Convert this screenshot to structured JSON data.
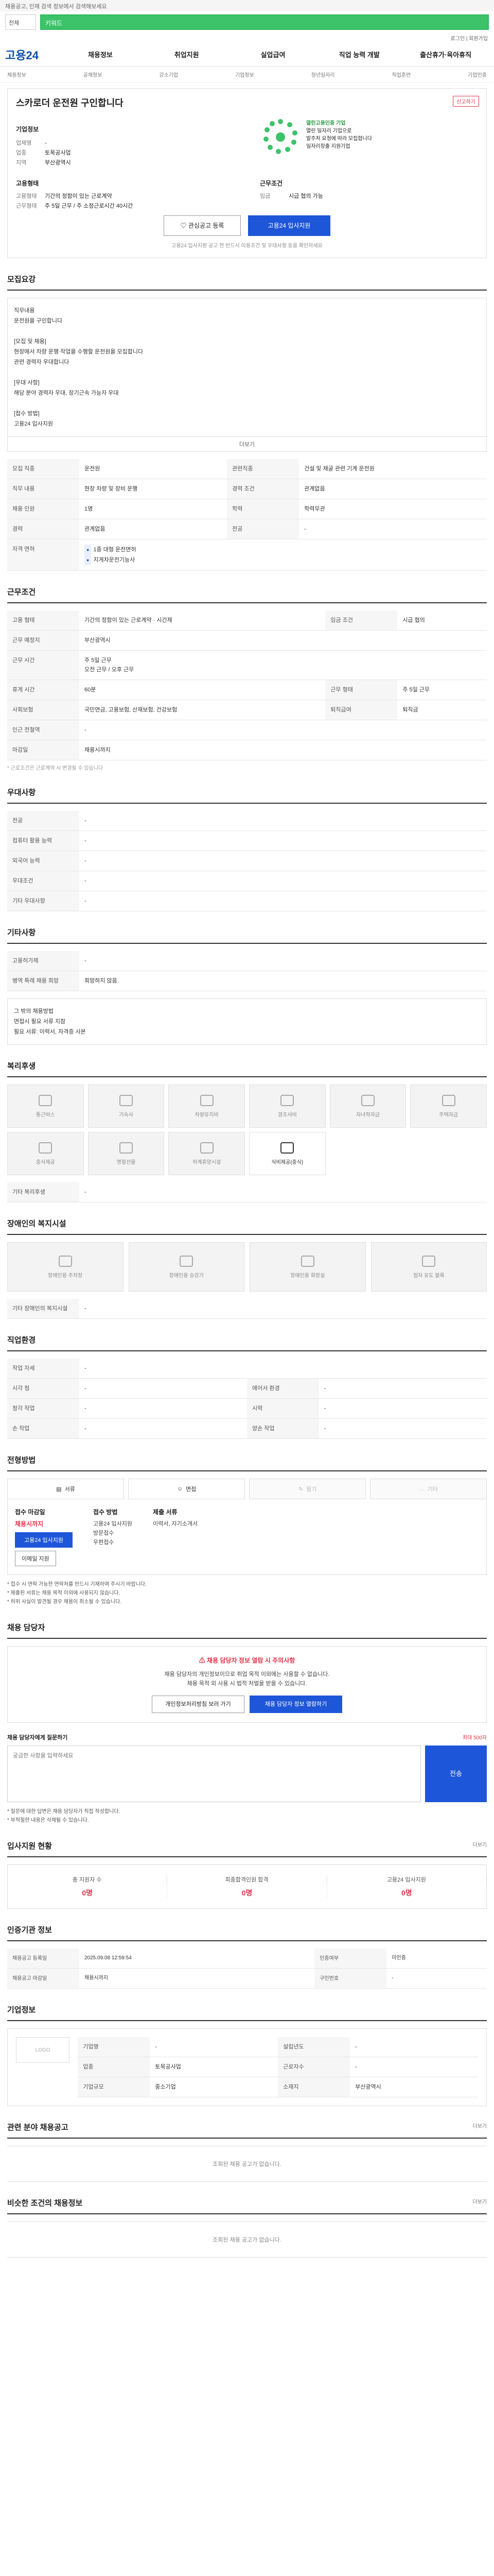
{
  "topbar": {
    "notice": "채용공고, 인재 검색 정보에서 검색해보세요"
  },
  "search": {
    "category": "전체",
    "query": "키워드"
  },
  "util": {
    "links": "로그인 | 회원가입"
  },
  "gnb": {
    "logo": "고용24",
    "items": [
      "채용정보",
      "취업지원",
      "실업급여",
      "직업 능력 개발",
      "출산휴가·육아휴직"
    ]
  },
  "subnav": {
    "items": [
      "채용정보",
      "공채정보",
      "강소기업",
      "기업정보",
      "청년일자리",
      "직업훈련",
      "기업인증"
    ]
  },
  "job": {
    "title": "스카로더 운전원 구인합니다",
    "report": "신고하기",
    "company_label": "기업정보",
    "company": [
      {
        "k": "업체명",
        "v": "-"
      },
      {
        "k": "업종",
        "v": "토목공사업"
      },
      {
        "k": "지역",
        "v": "부산광역시"
      }
    ],
    "emblem_title": "열린고용인증 기업",
    "emblem_lines": [
      "열린 일자리 기업으로",
      "발주처 요청에 따라 모집합니다",
      "일자리창출 지원기업"
    ],
    "hire_label": "고용형태",
    "hire": [
      {
        "k": "고용형태",
        "v": "기간의 정함이 있는 근로계약"
      },
      {
        "k": "근무형태",
        "v": "주 5일 근무 / 주 소정근로시간 40시간"
      }
    ],
    "work_label": "근무조건",
    "work": [
      {
        "k": "임금",
        "v": "시급 협의 가능"
      }
    ],
    "btn_interest": "관심공고 등록",
    "btn_apply": "고용24 입사지원",
    "disclaimer": "고용24 입사지원 공고 전 반드시 이용조건 및 우대사항 등을 확인하세요"
  },
  "detail": {
    "title": "모집요강",
    "body": "직무내용\n 운전원을 구인합니다\n\n[모집 및 채용]\n 현장에서 차량 운행 작업을 수행할 운전원을 모집합니다\n 관련 경력자 우대합니다\n\n[우대 사항]\n 해당 분야 경력자 우대, 장기근속 가능자 우대\n\n[접수 방법]\n 고용24 입사지원",
    "more": "더보기",
    "rows": [
      {
        "k": "모집 직종",
        "v": "운전원",
        "k2": "관련직종",
        "v2": "건설 및 채굴 관련 기계 운전원"
      },
      {
        "k": "직무 내용",
        "v": "현장 차량 및 장비 운행",
        "k2": "경력 조건",
        "v2": "관계없음"
      },
      {
        "k": "채용 인원",
        "v": "1명",
        "k2": "학력",
        "v2": "학력무관"
      },
      {
        "k": "경력",
        "v": "관계없음",
        "k2": "전공",
        "v2": "-"
      }
    ],
    "license_k": "자격 면허",
    "licenses": [
      "1종 대형 운전면허",
      "지게차운전기능사"
    ]
  },
  "condition": {
    "title": "근무조건",
    "rows": [
      {
        "k": "고용 형태",
        "v": "기간의 정함이 있는 근로계약 · 시간제",
        "k2": "임금 조건",
        "v2": "시급 협의"
      },
      {
        "k": "근무 예정지",
        "v": "부산광역시",
        "k2": "",
        "v2": ""
      },
      {
        "k": "근무 시간",
        "v": "주 5일 근무\n오전 근무 / 오후 근무",
        "k2": "",
        "v2": ""
      },
      {
        "k": "휴게 시간",
        "v": "60분",
        "k2": "근무 형태",
        "v2": "주 5일 근무"
      },
      {
        "k": "사회보험",
        "v": "국민연금, 고용보험, 산재보험, 건강보험",
        "k2": "퇴직급여",
        "v2": "퇴직금"
      },
      {
        "k": "인근 전철역",
        "v": "-",
        "k2": "",
        "v2": ""
      },
      {
        "k": "마감일",
        "v": "채용시까지",
        "k2": "",
        "v2": ""
      }
    ],
    "note": "* 근로조건은 근로계약 시 변경될 수 있습니다"
  },
  "preference": {
    "title": "우대사항",
    "rows": [
      {
        "k": "전공",
        "v": "-"
      },
      {
        "k": "컴퓨터 활용 능력",
        "v": "-"
      },
      {
        "k": "외국어 능력",
        "v": "-"
      },
      {
        "k": "우대조건",
        "v": "-"
      },
      {
        "k": "기타 우대사항",
        "v": "-"
      }
    ]
  },
  "other": {
    "title": "기타사항",
    "rows": [
      {
        "k": "고용허가제",
        "v": "-"
      },
      {
        "k": "병역 특례 채용 희망",
        "v": "희망하지 않음"
      }
    ],
    "box": "그 밖의 채용방법\n 면접시 필요 서류 지참\n 필요 서류: 이력서, 자격증 사본"
  },
  "welfare": {
    "title": "복리후생",
    "items": [
      "통근버스",
      "기숙사",
      "차량유지비",
      "경조사비",
      "자녀학자금",
      "주택자금",
      "중식제공",
      "명절선물",
      "하계휴양시설",
      "식비제공(중식)"
    ],
    "active": 9,
    "other_k": "기타 복리후생",
    "other_v": "-"
  },
  "disability": {
    "title": "장애인의 복지시설",
    "items": [
      "장애인용 주차장",
      "장애인용 승강기",
      "장애인용 화장실",
      "점자 유도 블록"
    ],
    "other_k": "기타 장애인의 복지시설",
    "other_v": "-"
  },
  "pref2": {
    "title": "직업환경",
    "rows": [
      {
        "k": "작업 자세",
        "v": "-",
        "k2": "",
        "v2": ""
      },
      {
        "k": "시각 청",
        "v": "-",
        "k2": "에어서 환경",
        "v2": "-"
      },
      {
        "k": "청각 작업",
        "v": "-",
        "k2": "시력",
        "v2": "-"
      },
      {
        "k": "손 작업",
        "v": "-",
        "k2": "양손 작업",
        "v2": "-"
      }
    ]
  },
  "apply": {
    "title": "전형방법",
    "tabs": [
      "서류",
      "면접",
      "필기",
      "기타"
    ],
    "dim_tabs": [
      2,
      3
    ],
    "col1_title": "접수 마감일",
    "deadline": "채용시까지",
    "btn_apply": "고용24 입사지원",
    "btn_email": "이메일 지원",
    "col2_title": "접수 방법",
    "methods": [
      "고용24 입사지원",
      "방문접수",
      "우편접수"
    ],
    "col3_title": "제출 서류",
    "docs": [
      "이력서, 자기소개서"
    ],
    "bullets": [
      "* 접수 시 연락 가능한 연락처를 반드시 기재하여 주시기 바랍니다.",
      "* 제출된 서류는 채용 목적 이외에 사용되지 않습니다.",
      "* 허위 사실이 발견될 경우 채용이 취소될 수 있습니다."
    ]
  },
  "contact": {
    "title": "채용 담당자",
    "warn_title": "채용 담당자 정보 열람 시 주의사항",
    "warn_lines": [
      "채용 담당자의 개인정보이므로 취업 목적 이외에는 사용할 수 없습니다.",
      "채용 목적 외 사용 시 법적 처벌을 받을 수 있습니다."
    ],
    "btn_a": "개인정보처리방침 보러 가기",
    "btn_b": "채용 담당자 정보 열람하기",
    "qa_label": "채용 담당자에게 질문하기",
    "qa_limit": "최대 500자",
    "qa_placeholder": "궁금한 사항을 입력하세요",
    "qa_send": "전송",
    "qa_notes": [
      "* 질문에 대한 답변은 채용 담당자가 직접 작성합니다.",
      "* 부적절한 내용은 삭제될 수 있습니다."
    ]
  },
  "stats": {
    "title": "입사지원 현황",
    "note": "더보기",
    "items": [
      {
        "t": "총 지원자 수",
        "v": "0명"
      },
      {
        "t": "최종합격인원 합격",
        "v": "0명"
      },
      {
        "t": "고용24 입사지원",
        "v": "0명"
      }
    ]
  },
  "auth": {
    "title": "인증기관 정보",
    "rows": [
      {
        "k": "채용공고 등록일",
        "v": "2025.09.08 12:59:54",
        "k2": "인증여부",
        "v2": "미인증"
      },
      {
        "k": "채용공고 마감일",
        "v": "채용시까지",
        "k2": "구인번호",
        "v2": "-"
      }
    ]
  },
  "corp": {
    "title": "기업정보",
    "logo": "LOGO",
    "rows": [
      {
        "k": "기업명",
        "v": "-",
        "k2": "설립년도",
        "v2": "-"
      },
      {
        "k": "업종",
        "v": "토목공사업",
        "k2": "근로자수",
        "v2": "-"
      },
      {
        "k": "기업규모",
        "v": "중소기업",
        "k2": "소재지",
        "v2": "부산광역시"
      }
    ]
  },
  "recent": {
    "title": "관련 분야 채용공고",
    "note": "더보기",
    "empty": "조회된 채용 공고가 없습니다."
  },
  "similar": {
    "title": "비슷한 조건의 채용정보",
    "note": "더보기",
    "empty": "조회된 채용 공고가 없습니다."
  }
}
